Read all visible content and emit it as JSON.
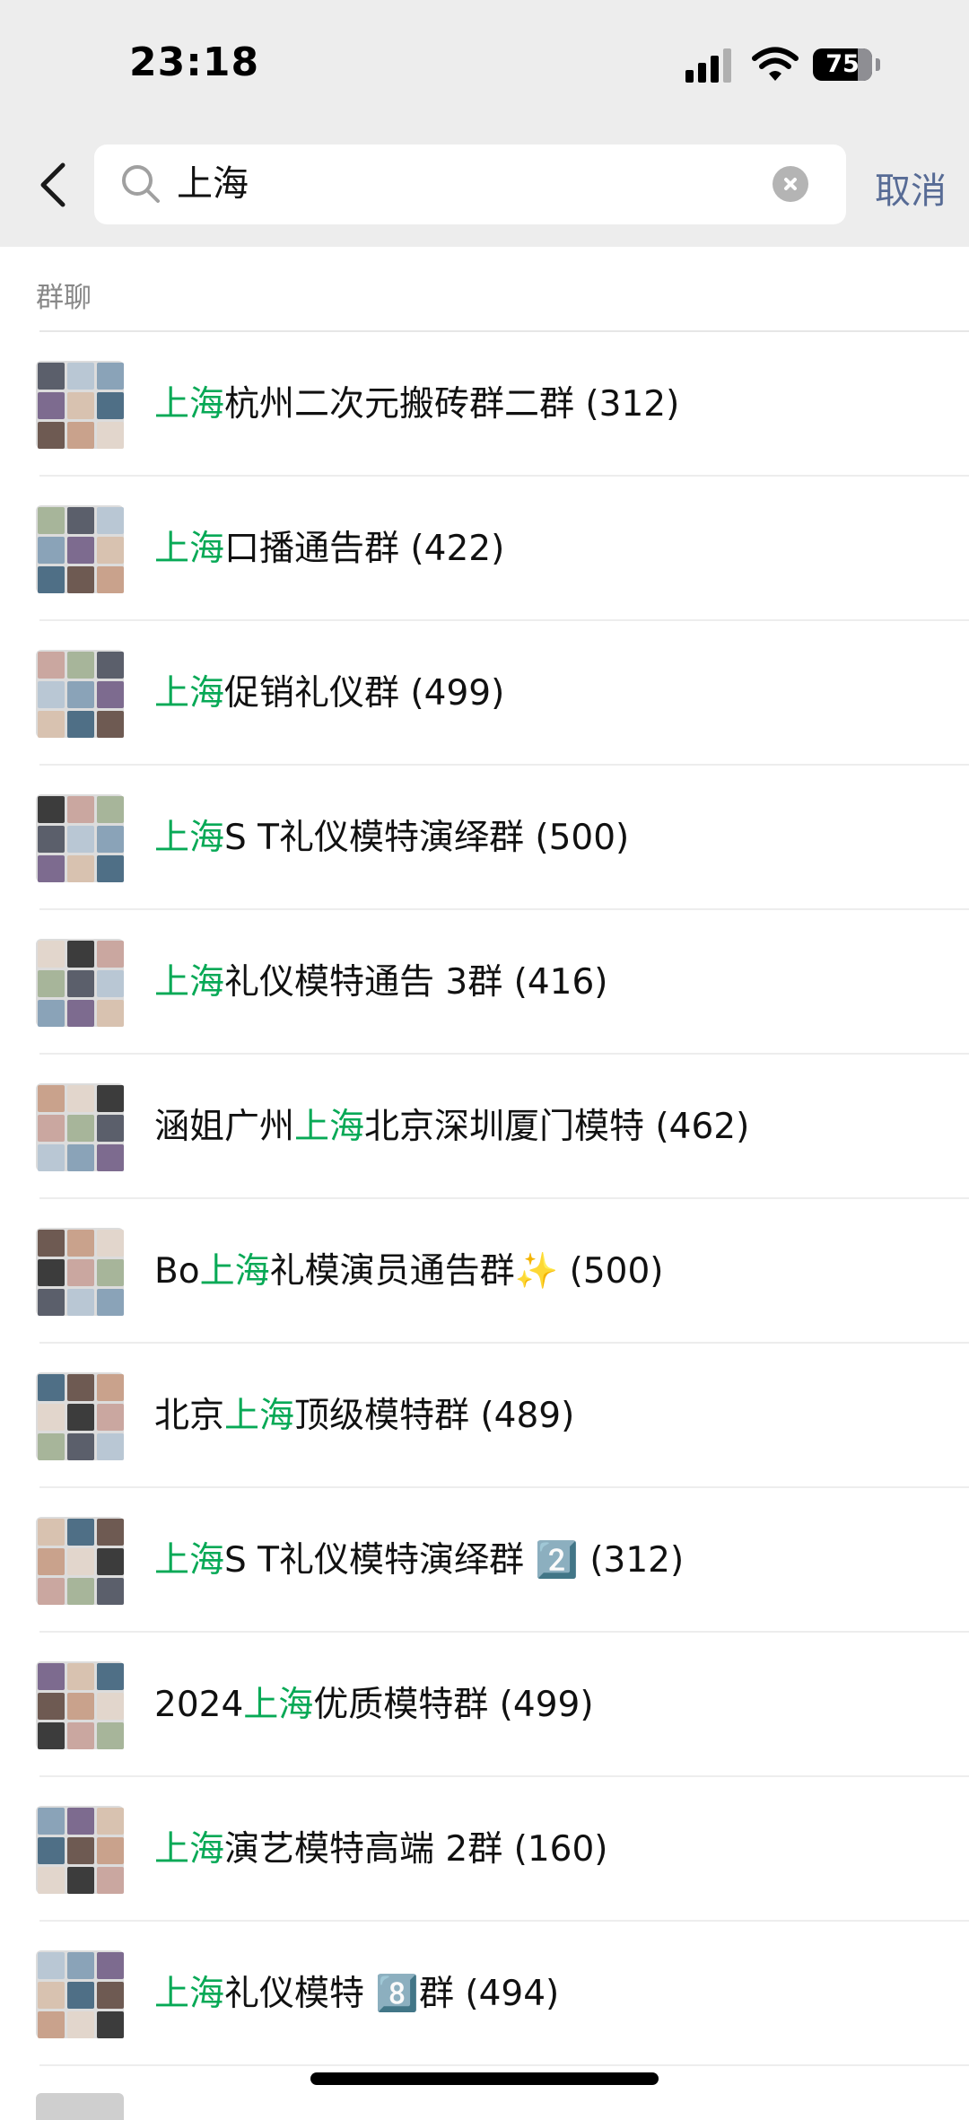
{
  "status_bar": {
    "time": "23:18",
    "battery": "75"
  },
  "search": {
    "query": "上海",
    "cancel_label": "取消"
  },
  "section": {
    "title": "群聊"
  },
  "colors": {
    "highlight": "#07a956",
    "link": "#576b95",
    "header_bg": "#ededed"
  },
  "icons": [
    "back-chevron-icon",
    "search-icon",
    "clear-icon",
    "signal-icon",
    "wifi-icon",
    "battery-icon"
  ],
  "groups": [
    {
      "pre": "",
      "hl": "上海",
      "post": "杭州二次元搬砖群二群 (312)"
    },
    {
      "pre": "",
      "hl": "上海",
      "post": "口播通告群 (422)"
    },
    {
      "pre": "",
      "hl": "上海",
      "post": "促销礼仪群 (499)"
    },
    {
      "pre": "",
      "hl": "上海",
      "post": "S T礼仪模特演绎群 (500)"
    },
    {
      "pre": "",
      "hl": "上海",
      "post": "礼仪模特通告 3群 (416)"
    },
    {
      "pre": "涵姐广州",
      "hl": "上海",
      "post": "北京深圳厦门模特 (462)"
    },
    {
      "pre": "Bo",
      "hl": "上海",
      "post": "礼模演员通告群✨ (500)"
    },
    {
      "pre": "北京",
      "hl": "上海",
      "post": "顶级模特群 (489)"
    },
    {
      "pre": "",
      "hl": "上海",
      "post": "S T礼仪模特演绎群 2️⃣ (312)"
    },
    {
      "pre": "2024",
      "hl": "上海",
      "post": "优质模特群 (499)"
    },
    {
      "pre": "",
      "hl": "上海",
      "post": "演艺模特高端 2群 (160)"
    },
    {
      "pre": "",
      "hl": "上海",
      "post": "礼仪模特 8️⃣群 (494)"
    }
  ]
}
